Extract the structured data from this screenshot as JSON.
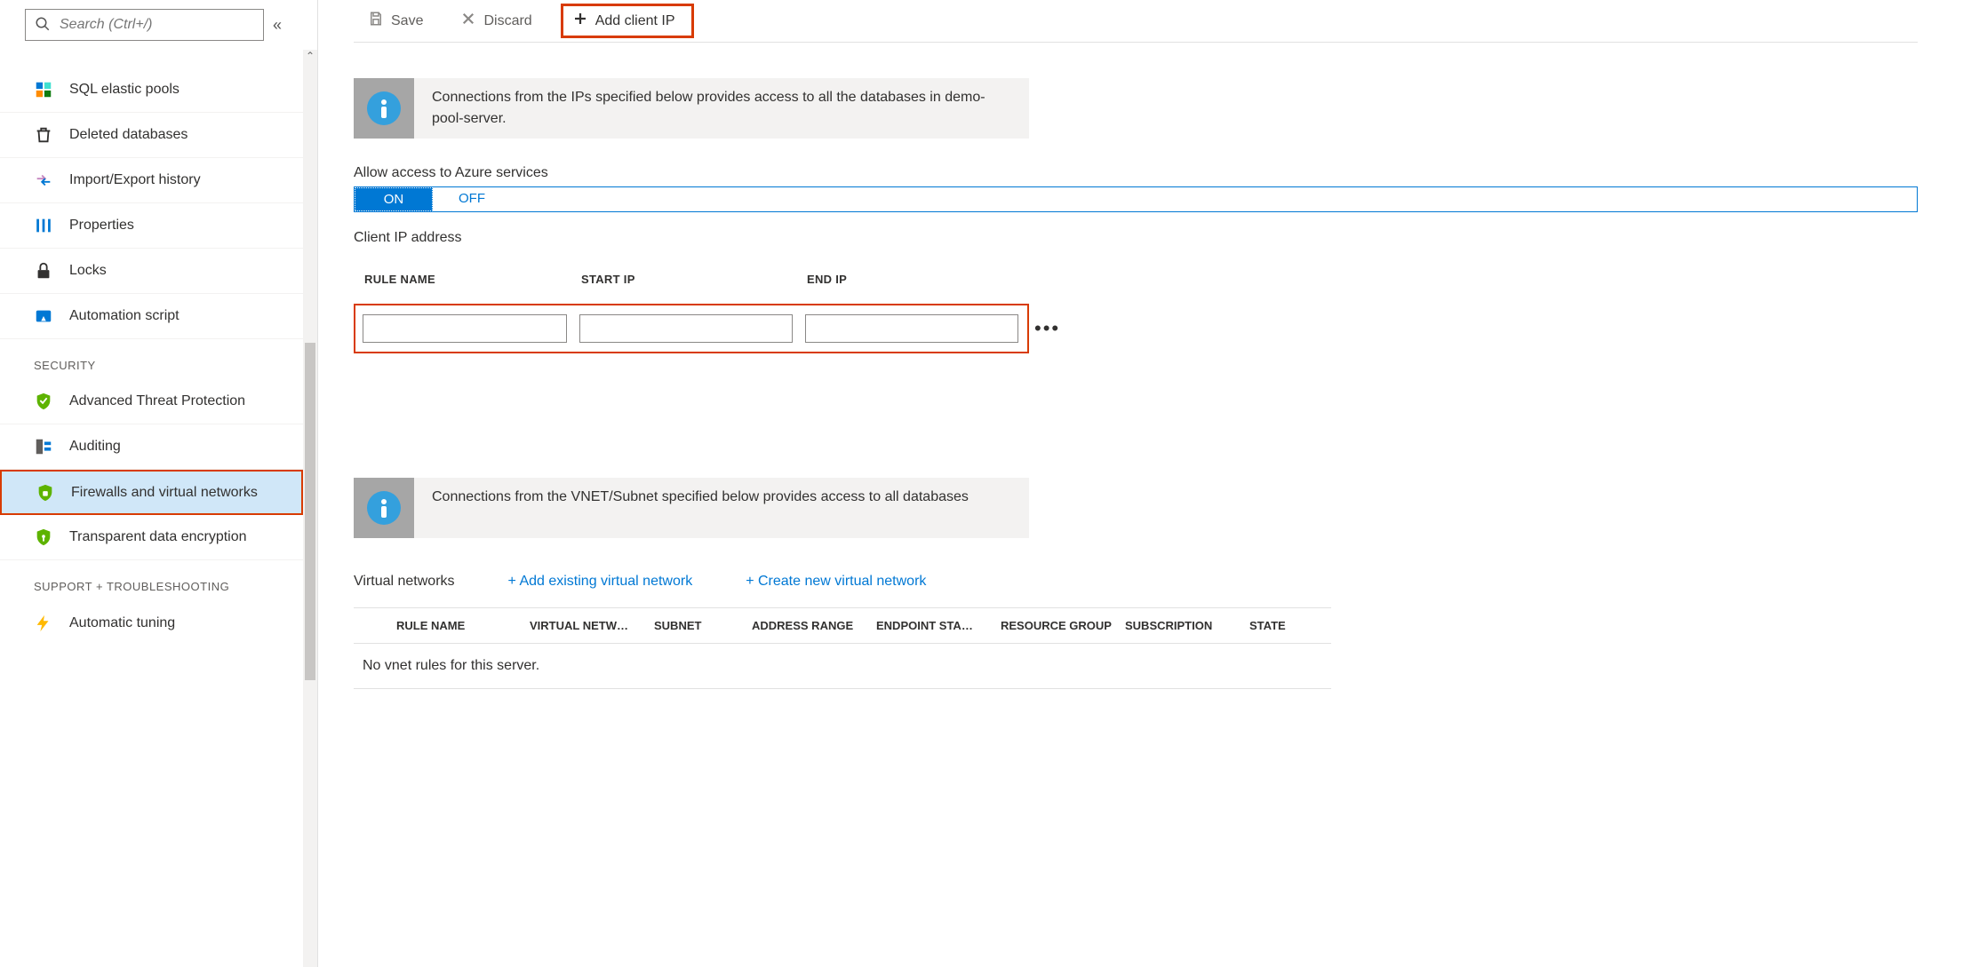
{
  "sidebar": {
    "search_placeholder": "Search (Ctrl+/)",
    "items_top": [
      {
        "label": "SQL elastic pools"
      },
      {
        "label": "Deleted databases"
      },
      {
        "label": "Import/Export history"
      },
      {
        "label": "Properties"
      },
      {
        "label": "Locks"
      },
      {
        "label": "Automation script"
      }
    ],
    "security_header": "SECURITY",
    "items_security": [
      {
        "label": "Advanced Threat Protection"
      },
      {
        "label": "Auditing"
      },
      {
        "label": "Firewalls and virtual networks"
      },
      {
        "label": "Transparent data encryption"
      }
    ],
    "support_header": "SUPPORT + TROUBLESHOOTING",
    "items_support": [
      {
        "label": "Automatic tuning"
      }
    ]
  },
  "toolbar": {
    "save_label": "Save",
    "discard_label": "Discard",
    "add_client_ip_label": "Add client IP"
  },
  "info1": "Connections from the IPs specified below provides access to all the databases in demo-pool-server.",
  "allow_access_label": "Allow access to Azure services",
  "toggle": {
    "on": "ON",
    "off": "OFF"
  },
  "client_ip_label": "Client IP address",
  "fw_headers": {
    "rule": "RULE NAME",
    "start": "START IP",
    "end": "END IP"
  },
  "info2": "Connections from the VNET/Subnet specified below provides access to all databases",
  "vnet_title": "Virtual networks",
  "vnet_add_existing": "+ Add existing virtual network",
  "vnet_create_new": "+ Create new virtual network",
  "vnet_cols": {
    "rule": "RULE NAME",
    "vnet": "VIRTUAL NETW…",
    "subnet": "SUBNET",
    "range": "ADDRESS RANGE",
    "endpoint": "ENDPOINT STA…",
    "rg": "RESOURCE GROUP",
    "sub": "SUBSCRIPTION",
    "state": "STATE"
  },
  "vnet_empty": "No vnet rules for this server."
}
